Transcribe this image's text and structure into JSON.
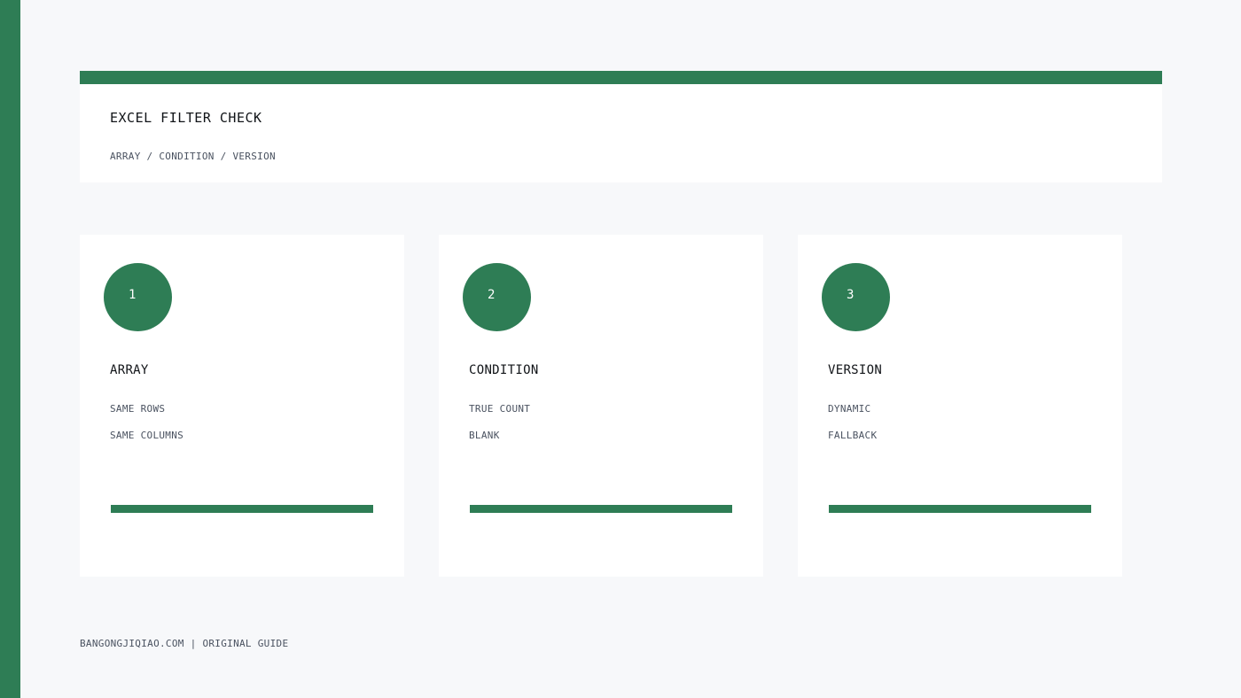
{
  "header": {
    "title": "EXCEL FILTER CHECK",
    "subtitle": "ARRAY / CONDITION / VERSION"
  },
  "steps": [
    {
      "number": "1",
      "title": "ARRAY",
      "line1": "SAME ROWS",
      "line2": "SAME COLUMNS"
    },
    {
      "number": "2",
      "title": "CONDITION",
      "line1": "TRUE COUNT",
      "line2": "BLANK"
    },
    {
      "number": "3",
      "title": "VERSION",
      "line1": "DYNAMIC",
      "line2": "FALLBACK"
    }
  ],
  "footer": {
    "text": "BANGONGJIQIAO.COM | ORIGINAL GUIDE"
  },
  "colors": {
    "accent": "#2e7d55",
    "background": "#f7f8fa",
    "card": "#ffffff"
  }
}
